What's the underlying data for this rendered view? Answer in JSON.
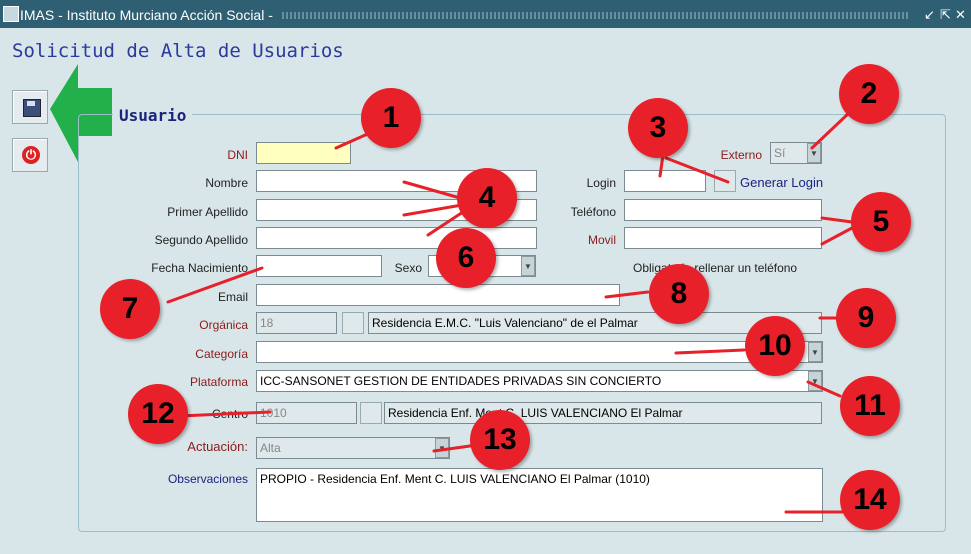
{
  "window": {
    "title": "IMAS - Instituto Murciano Acción Social -",
    "controls": [
      "↙",
      "⇱",
      "✕"
    ]
  },
  "page_title": "Solicitud de Alta de Usuarios",
  "toolbar": {
    "save_icon": "save-icon",
    "exit_icon": "power-icon"
  },
  "group_title": "Usuario",
  "form": {
    "dni": {
      "label": "DNI",
      "value": ""
    },
    "nombre": {
      "label": "Nombre",
      "value": ""
    },
    "primer_apellido": {
      "label": "Primer Apellido",
      "value": ""
    },
    "segundo_apellido": {
      "label": "Segundo Apellido",
      "value": ""
    },
    "fecha_nacimiento": {
      "label": "Fecha Nacimiento",
      "value": ""
    },
    "sexo": {
      "label": "Sexo",
      "value": ""
    },
    "email": {
      "label": "Email",
      "value": ""
    },
    "organica": {
      "label": "Orgánica",
      "code": "18",
      "description": "Residencia E.M.C. \"Luis Valenciano\" de el Palmar"
    },
    "categoria": {
      "label": "Categoría",
      "value": ""
    },
    "plataforma": {
      "label": "Plataforma",
      "value": "ICC-SANSONET GESTION DE ENTIDADES PRIVADAS SIN CONCIERTO"
    },
    "centro": {
      "label": "Centro",
      "code": "1010",
      "description": "Residencia Enf. Ment C. LUIS VALENCIANO  El Palmar"
    },
    "actuacion": {
      "label": "Actuación:",
      "value": "Alta"
    },
    "observaciones": {
      "label": "Observaciones",
      "value": "PROPIO - Residencia Enf. Ment C. LUIS VALENCIANO  El Palmar (1010)"
    },
    "externo": {
      "label": "Externo",
      "value": "Sí"
    },
    "login": {
      "label": "Login",
      "value": ""
    },
    "generar_login": "Generar Login",
    "telefono": {
      "label": "Teléfono",
      "value": ""
    },
    "movil": {
      "label": "Movil",
      "value": ""
    },
    "phone_note": "Obligatorio rellenar un teléfono"
  },
  "callouts": [
    "1",
    "2",
    "3",
    "4",
    "5",
    "6",
    "7",
    "8",
    "9",
    "10",
    "11",
    "12",
    "13",
    "14"
  ],
  "colors": {
    "callout": "#e8202a",
    "arrow": "#22b04b",
    "required_label": "#8b1a1a",
    "title": "#2b3a9c"
  }
}
